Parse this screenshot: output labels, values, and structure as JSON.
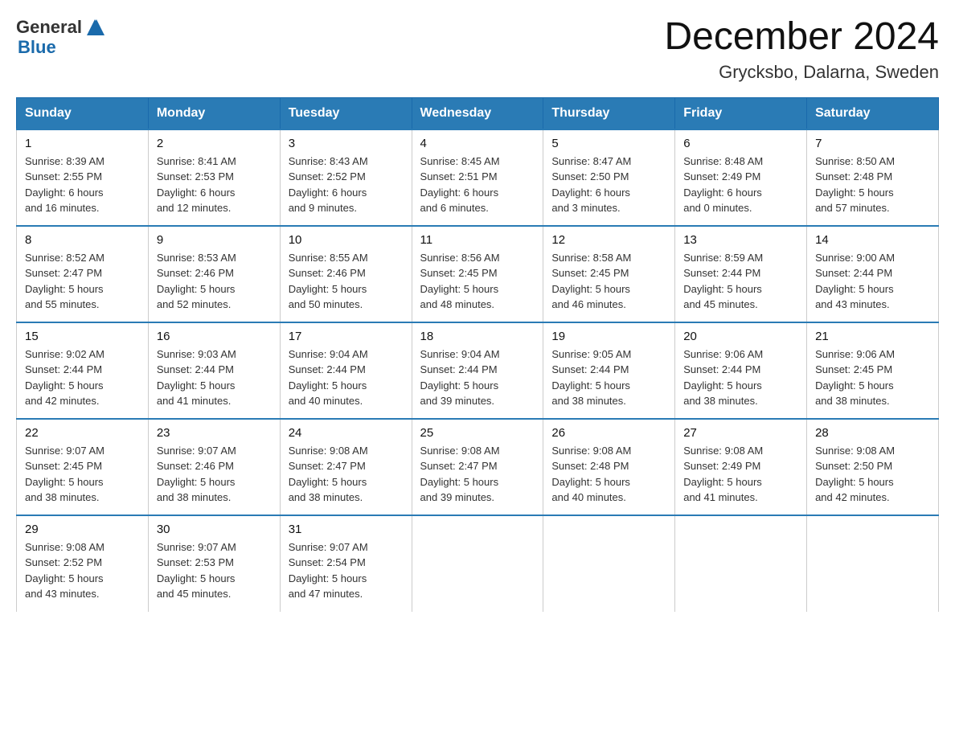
{
  "header": {
    "title": "December 2024",
    "subtitle": "Grycksbo, Dalarna, Sweden",
    "logo_general": "General",
    "logo_blue": "Blue"
  },
  "columns": [
    "Sunday",
    "Monday",
    "Tuesday",
    "Wednesday",
    "Thursday",
    "Friday",
    "Saturday"
  ],
  "weeks": [
    [
      {
        "day": "1",
        "info": "Sunrise: 8:39 AM\nSunset: 2:55 PM\nDaylight: 6 hours\nand 16 minutes."
      },
      {
        "day": "2",
        "info": "Sunrise: 8:41 AM\nSunset: 2:53 PM\nDaylight: 6 hours\nand 12 minutes."
      },
      {
        "day": "3",
        "info": "Sunrise: 8:43 AM\nSunset: 2:52 PM\nDaylight: 6 hours\nand 9 minutes."
      },
      {
        "day": "4",
        "info": "Sunrise: 8:45 AM\nSunset: 2:51 PM\nDaylight: 6 hours\nand 6 minutes."
      },
      {
        "day": "5",
        "info": "Sunrise: 8:47 AM\nSunset: 2:50 PM\nDaylight: 6 hours\nand 3 minutes."
      },
      {
        "day": "6",
        "info": "Sunrise: 8:48 AM\nSunset: 2:49 PM\nDaylight: 6 hours\nand 0 minutes."
      },
      {
        "day": "7",
        "info": "Sunrise: 8:50 AM\nSunset: 2:48 PM\nDaylight: 5 hours\nand 57 minutes."
      }
    ],
    [
      {
        "day": "8",
        "info": "Sunrise: 8:52 AM\nSunset: 2:47 PM\nDaylight: 5 hours\nand 55 minutes."
      },
      {
        "day": "9",
        "info": "Sunrise: 8:53 AM\nSunset: 2:46 PM\nDaylight: 5 hours\nand 52 minutes."
      },
      {
        "day": "10",
        "info": "Sunrise: 8:55 AM\nSunset: 2:46 PM\nDaylight: 5 hours\nand 50 minutes."
      },
      {
        "day": "11",
        "info": "Sunrise: 8:56 AM\nSunset: 2:45 PM\nDaylight: 5 hours\nand 48 minutes."
      },
      {
        "day": "12",
        "info": "Sunrise: 8:58 AM\nSunset: 2:45 PM\nDaylight: 5 hours\nand 46 minutes."
      },
      {
        "day": "13",
        "info": "Sunrise: 8:59 AM\nSunset: 2:44 PM\nDaylight: 5 hours\nand 45 minutes."
      },
      {
        "day": "14",
        "info": "Sunrise: 9:00 AM\nSunset: 2:44 PM\nDaylight: 5 hours\nand 43 minutes."
      }
    ],
    [
      {
        "day": "15",
        "info": "Sunrise: 9:02 AM\nSunset: 2:44 PM\nDaylight: 5 hours\nand 42 minutes."
      },
      {
        "day": "16",
        "info": "Sunrise: 9:03 AM\nSunset: 2:44 PM\nDaylight: 5 hours\nand 41 minutes."
      },
      {
        "day": "17",
        "info": "Sunrise: 9:04 AM\nSunset: 2:44 PM\nDaylight: 5 hours\nand 40 minutes."
      },
      {
        "day": "18",
        "info": "Sunrise: 9:04 AM\nSunset: 2:44 PM\nDaylight: 5 hours\nand 39 minutes."
      },
      {
        "day": "19",
        "info": "Sunrise: 9:05 AM\nSunset: 2:44 PM\nDaylight: 5 hours\nand 38 minutes."
      },
      {
        "day": "20",
        "info": "Sunrise: 9:06 AM\nSunset: 2:44 PM\nDaylight: 5 hours\nand 38 minutes."
      },
      {
        "day": "21",
        "info": "Sunrise: 9:06 AM\nSunset: 2:45 PM\nDaylight: 5 hours\nand 38 minutes."
      }
    ],
    [
      {
        "day": "22",
        "info": "Sunrise: 9:07 AM\nSunset: 2:45 PM\nDaylight: 5 hours\nand 38 minutes."
      },
      {
        "day": "23",
        "info": "Sunrise: 9:07 AM\nSunset: 2:46 PM\nDaylight: 5 hours\nand 38 minutes."
      },
      {
        "day": "24",
        "info": "Sunrise: 9:08 AM\nSunset: 2:47 PM\nDaylight: 5 hours\nand 38 minutes."
      },
      {
        "day": "25",
        "info": "Sunrise: 9:08 AM\nSunset: 2:47 PM\nDaylight: 5 hours\nand 39 minutes."
      },
      {
        "day": "26",
        "info": "Sunrise: 9:08 AM\nSunset: 2:48 PM\nDaylight: 5 hours\nand 40 minutes."
      },
      {
        "day": "27",
        "info": "Sunrise: 9:08 AM\nSunset: 2:49 PM\nDaylight: 5 hours\nand 41 minutes."
      },
      {
        "day": "28",
        "info": "Sunrise: 9:08 AM\nSunset: 2:50 PM\nDaylight: 5 hours\nand 42 minutes."
      }
    ],
    [
      {
        "day": "29",
        "info": "Sunrise: 9:08 AM\nSunset: 2:52 PM\nDaylight: 5 hours\nand 43 minutes."
      },
      {
        "day": "30",
        "info": "Sunrise: 9:07 AM\nSunset: 2:53 PM\nDaylight: 5 hours\nand 45 minutes."
      },
      {
        "day": "31",
        "info": "Sunrise: 9:07 AM\nSunset: 2:54 PM\nDaylight: 5 hours\nand 47 minutes."
      },
      null,
      null,
      null,
      null
    ]
  ]
}
